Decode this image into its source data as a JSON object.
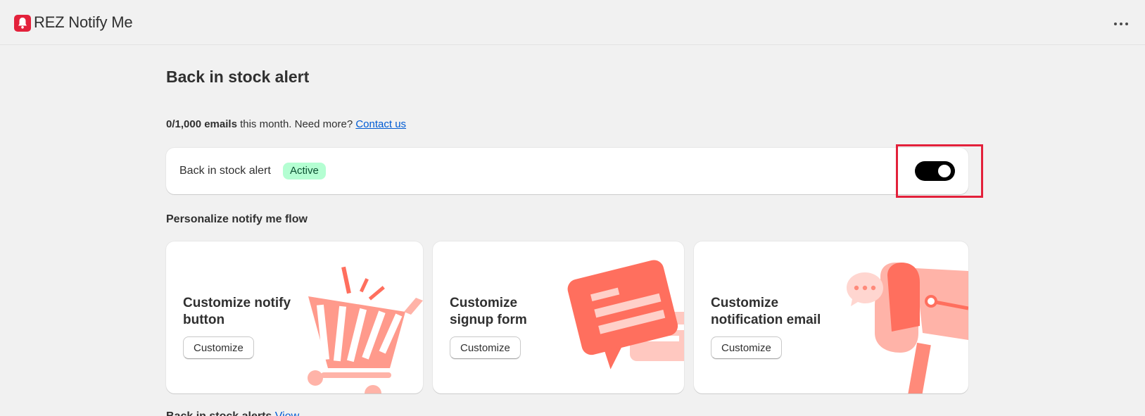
{
  "app": {
    "title": "REZ Notify Me",
    "brand_color": "#e3213b"
  },
  "page": {
    "title": "Back in stock alert"
  },
  "usage": {
    "count": "0/1,000 emails",
    "text": " this month. Need more? ",
    "link": "Contact us"
  },
  "status_card": {
    "label": "Back in stock alert",
    "badge": "Active",
    "toggle_on": true
  },
  "section": {
    "title": "Personalize notify me flow"
  },
  "cards": [
    {
      "title": "Customize notify button",
      "button": "Customize",
      "icon": "shopping-cart-icon"
    },
    {
      "title": "Customize signup form",
      "button": "Customize",
      "icon": "chat-bubble-icon"
    },
    {
      "title": "Customize notification email",
      "button": "Customize",
      "icon": "mailbox-icon"
    }
  ],
  "bottom": {
    "title": "Back in stock alerts",
    "link": "View"
  },
  "colors": {
    "illustration": "#ff6f5e",
    "illustration_light": "#ffb3a8"
  }
}
